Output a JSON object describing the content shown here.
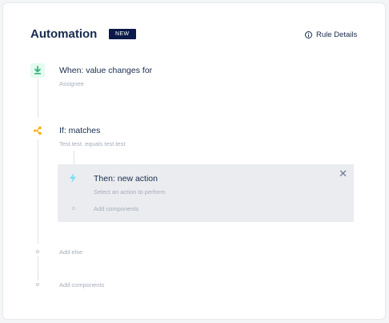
{
  "header": {
    "title": "Automation",
    "badge": "NEW",
    "rule_details": "Rule Details"
  },
  "trigger": {
    "heading": "When: value changes for",
    "detail": "Assignee",
    "icon": "download-arrow-icon",
    "color": "#36b37e"
  },
  "condition": {
    "heading": "If: matches",
    "detail": "Test.test. equals test.test",
    "icon": "branch-icon",
    "color": "#ffab00"
  },
  "action": {
    "heading": "Then: new action",
    "detail": "Select an action to perform",
    "add_components": "Add components",
    "icon": "lightning-icon",
    "color": "#79e2f2"
  },
  "footer": {
    "add_else": "Add else",
    "add_components": "Add components"
  },
  "colors": {
    "badge_bg": "#0b1a4a",
    "line": "#dfe1e6",
    "action_bg": "#ebecf0"
  }
}
